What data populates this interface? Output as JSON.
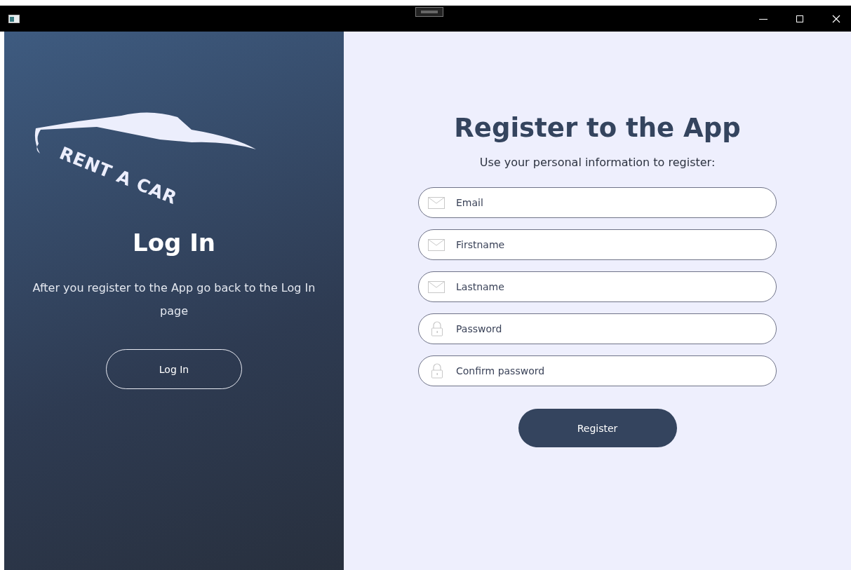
{
  "logo": {
    "text": "RENT A CAR"
  },
  "login_panel": {
    "title": "Log In",
    "text": "After you register to the App go back to the Log In page",
    "button": "Log In"
  },
  "register_panel": {
    "title": "Register to the App",
    "subtitle": "Use your personal information to register:",
    "fields": [
      {
        "kind": "mail",
        "placeholder": "Email"
      },
      {
        "kind": "mail",
        "placeholder": "Firstname"
      },
      {
        "kind": "mail",
        "placeholder": "Lastname"
      },
      {
        "kind": "lock",
        "placeholder": "Password"
      },
      {
        "kind": "lock",
        "placeholder": "Confirm password"
      }
    ],
    "button": "Register"
  }
}
